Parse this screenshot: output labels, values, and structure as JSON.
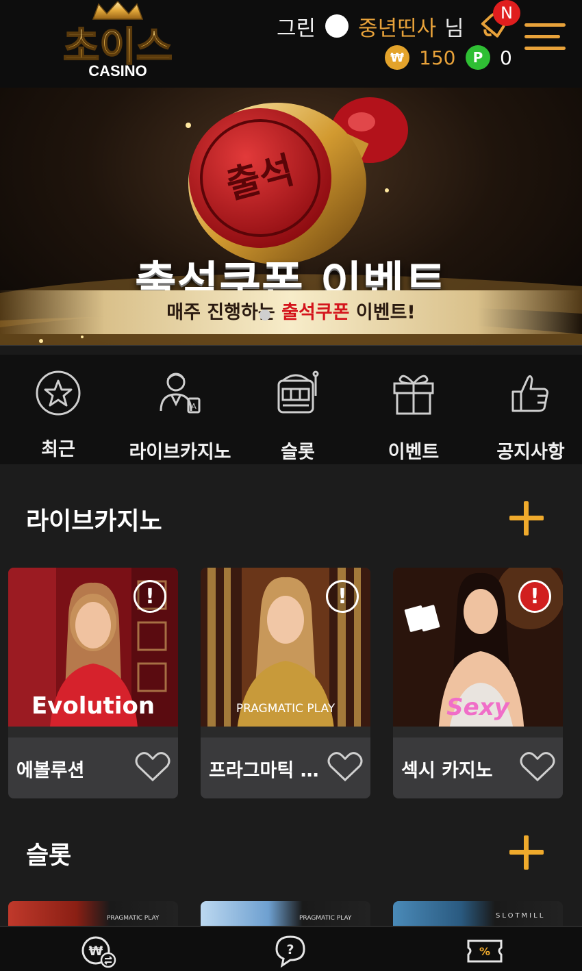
{
  "header": {
    "logo_text": "초이스",
    "logo_sub": "CASINO",
    "grade": "그린",
    "nickname": "중년띤사",
    "honorific": "님",
    "notification_badge": "N",
    "balance_symbol": "₩",
    "balance": "150",
    "point_symbol": "P",
    "points": "0",
    "icons": [
      "bell-icon",
      "hamburger-menu-icon"
    ]
  },
  "banner": {
    "title": "출석쿠폰 이벤트",
    "subtitle_prefix": "매주 진행하는",
    "subtitle_highlight": "출석쿠폰",
    "subtitle_suffix": "이벤트!",
    "stamp_text": "출석"
  },
  "categories": [
    {
      "label": "최근",
      "icon": "star-icon"
    },
    {
      "label": "라이브카지노",
      "icon": "dealer-icon"
    },
    {
      "label": "슬롯",
      "icon": "slot-machine-icon"
    },
    {
      "label": "이벤트",
      "icon": "gift-icon"
    },
    {
      "label": "공지사항",
      "icon": "thumbs-up-icon"
    }
  ],
  "live_section": {
    "title": "라이브카지노",
    "cards": [
      {
        "name": "에볼루션",
        "brand": "Evolution"
      },
      {
        "name": "프라그마틱 …",
        "brand": "PRAGMATIC PLAY"
      },
      {
        "name": "섹시 카지노",
        "brand": "Sexy"
      }
    ]
  },
  "slot_section": {
    "title": "슬롯",
    "cards": [
      {
        "brand": "PRAGMATIC PLAY"
      },
      {
        "brand": "PRAGMATIC PLAY"
      },
      {
        "brand": "SLOTMILL"
      }
    ]
  },
  "bottom_nav": {
    "icons": [
      "deposit-exchange-icon",
      "help-chat-icon",
      "coupon-ticket-icon"
    ],
    "coupon_symbol": "%",
    "deposit_symbol": "₩",
    "help_symbol": "?"
  },
  "colors": {
    "accent": "#efaa2c",
    "nickname": "#e8a23a",
    "badge": "#e01e1e",
    "point": "#2fbf34"
  }
}
